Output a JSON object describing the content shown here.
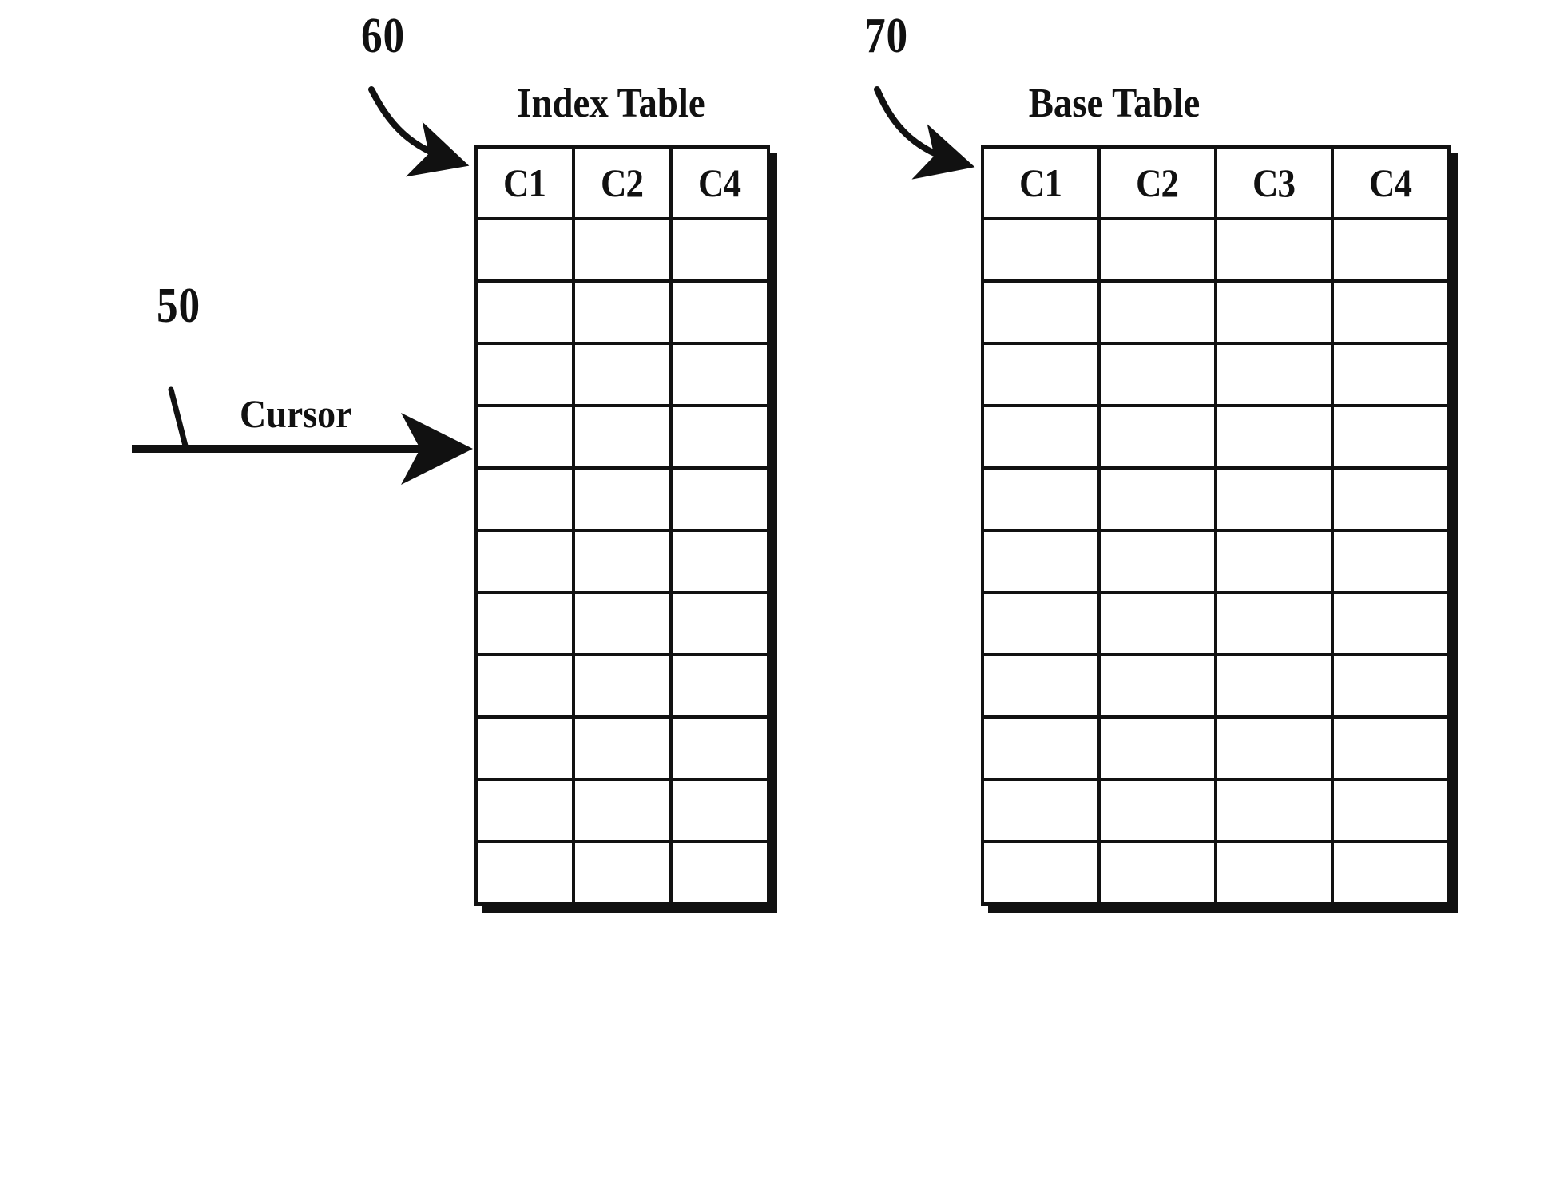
{
  "figure": {
    "type": "patent-diagram",
    "ink_color": "#111111",
    "background_color": "#ffffff"
  },
  "reference_numerals": {
    "index_table": "60",
    "base_table": "70",
    "cursor": "50"
  },
  "cursor": {
    "label": "Cursor",
    "points_to_table": "Index Table",
    "points_to_row_index": 4
  },
  "tables": [
    {
      "id": "index-table",
      "title": "Index Table",
      "reference": "60",
      "columns": [
        "C1",
        "C2",
        "C4"
      ],
      "data_row_count": 11,
      "rows": [
        [
          "",
          "",
          ""
        ],
        [
          "",
          "",
          ""
        ],
        [
          "",
          "",
          ""
        ],
        [
          "",
          "",
          ""
        ],
        [
          "",
          "",
          ""
        ],
        [
          "",
          "",
          ""
        ],
        [
          "",
          "",
          ""
        ],
        [
          "",
          "",
          ""
        ],
        [
          "",
          "",
          ""
        ],
        [
          "",
          "",
          ""
        ],
        [
          "",
          "",
          ""
        ]
      ]
    },
    {
      "id": "base-table",
      "title": "Base Table",
      "reference": "70",
      "columns": [
        "C1",
        "C2",
        "C3",
        "C4"
      ],
      "data_row_count": 11,
      "rows": [
        [
          "",
          "",
          "",
          ""
        ],
        [
          "",
          "",
          "",
          ""
        ],
        [
          "",
          "",
          "",
          ""
        ],
        [
          "",
          "",
          "",
          ""
        ],
        [
          "",
          "",
          "",
          ""
        ],
        [
          "",
          "",
          "",
          ""
        ],
        [
          "",
          "",
          "",
          ""
        ],
        [
          "",
          "",
          "",
          ""
        ],
        [
          "",
          "",
          "",
          ""
        ],
        [
          "",
          "",
          "",
          ""
        ],
        [
          "",
          "",
          "",
          ""
        ]
      ]
    }
  ]
}
